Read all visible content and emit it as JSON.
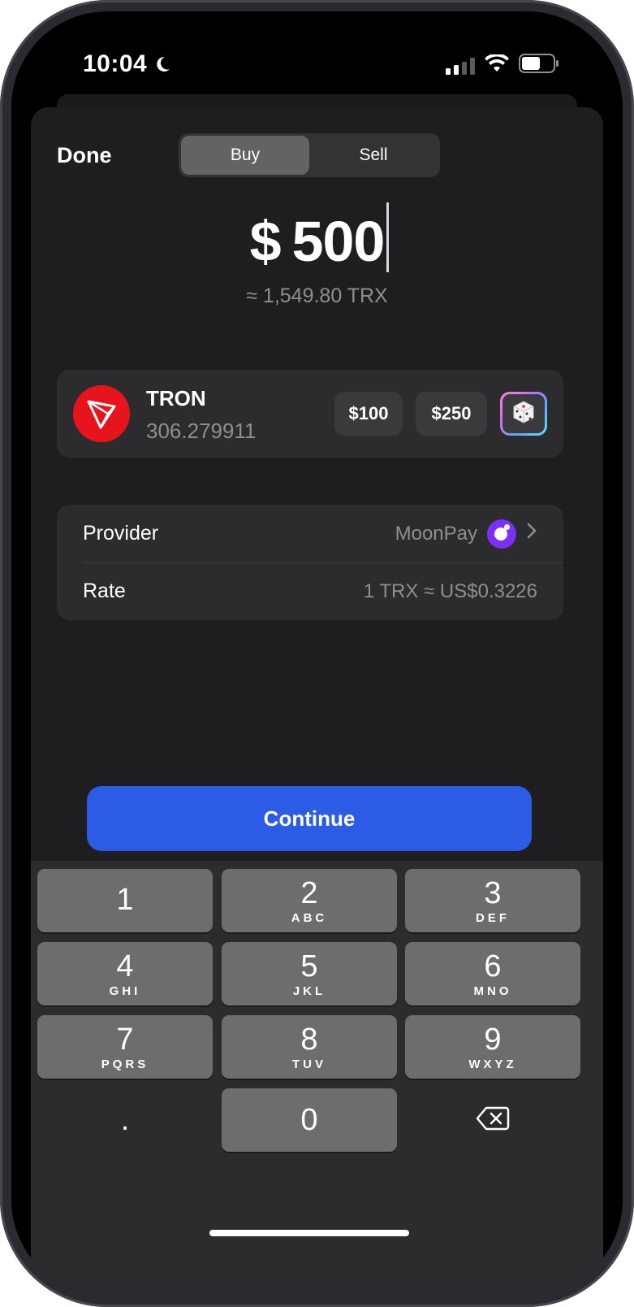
{
  "status_bar": {
    "time": "10:04"
  },
  "header": {
    "done_label": "Done",
    "tabs": [
      "Buy",
      "Sell"
    ],
    "active_tab": "Buy"
  },
  "amount": {
    "currency_symbol": "$",
    "value": "500",
    "conversion": "≈ 1,549.80 TRX"
  },
  "asset": {
    "name": "TRON",
    "balance": "306.279911",
    "quick_amounts": [
      "$100",
      "$250"
    ],
    "random_icon": "dice-icon"
  },
  "details": {
    "provider_label": "Provider",
    "provider_value": "MoonPay",
    "rate_label": "Rate",
    "rate_value": "1 TRX ≈ US$0.3226"
  },
  "continue_label": "Continue",
  "keypad": {
    "keys": [
      {
        "digit": "1",
        "letters": ""
      },
      {
        "digit": "2",
        "letters": "ABC"
      },
      {
        "digit": "3",
        "letters": "DEF"
      },
      {
        "digit": "4",
        "letters": "GHI"
      },
      {
        "digit": "5",
        "letters": "JKL"
      },
      {
        "digit": "6",
        "letters": "MNO"
      },
      {
        "digit": "7",
        "letters": "PQRS"
      },
      {
        "digit": "8",
        "letters": "TUV"
      },
      {
        "digit": "9",
        "letters": "WXYZ"
      }
    ],
    "decimal": ".",
    "zero": "0"
  },
  "colors": {
    "accent": "#2c5be6",
    "tron_red": "#e8141c",
    "moonpay_purple": "#7b2ff7"
  }
}
